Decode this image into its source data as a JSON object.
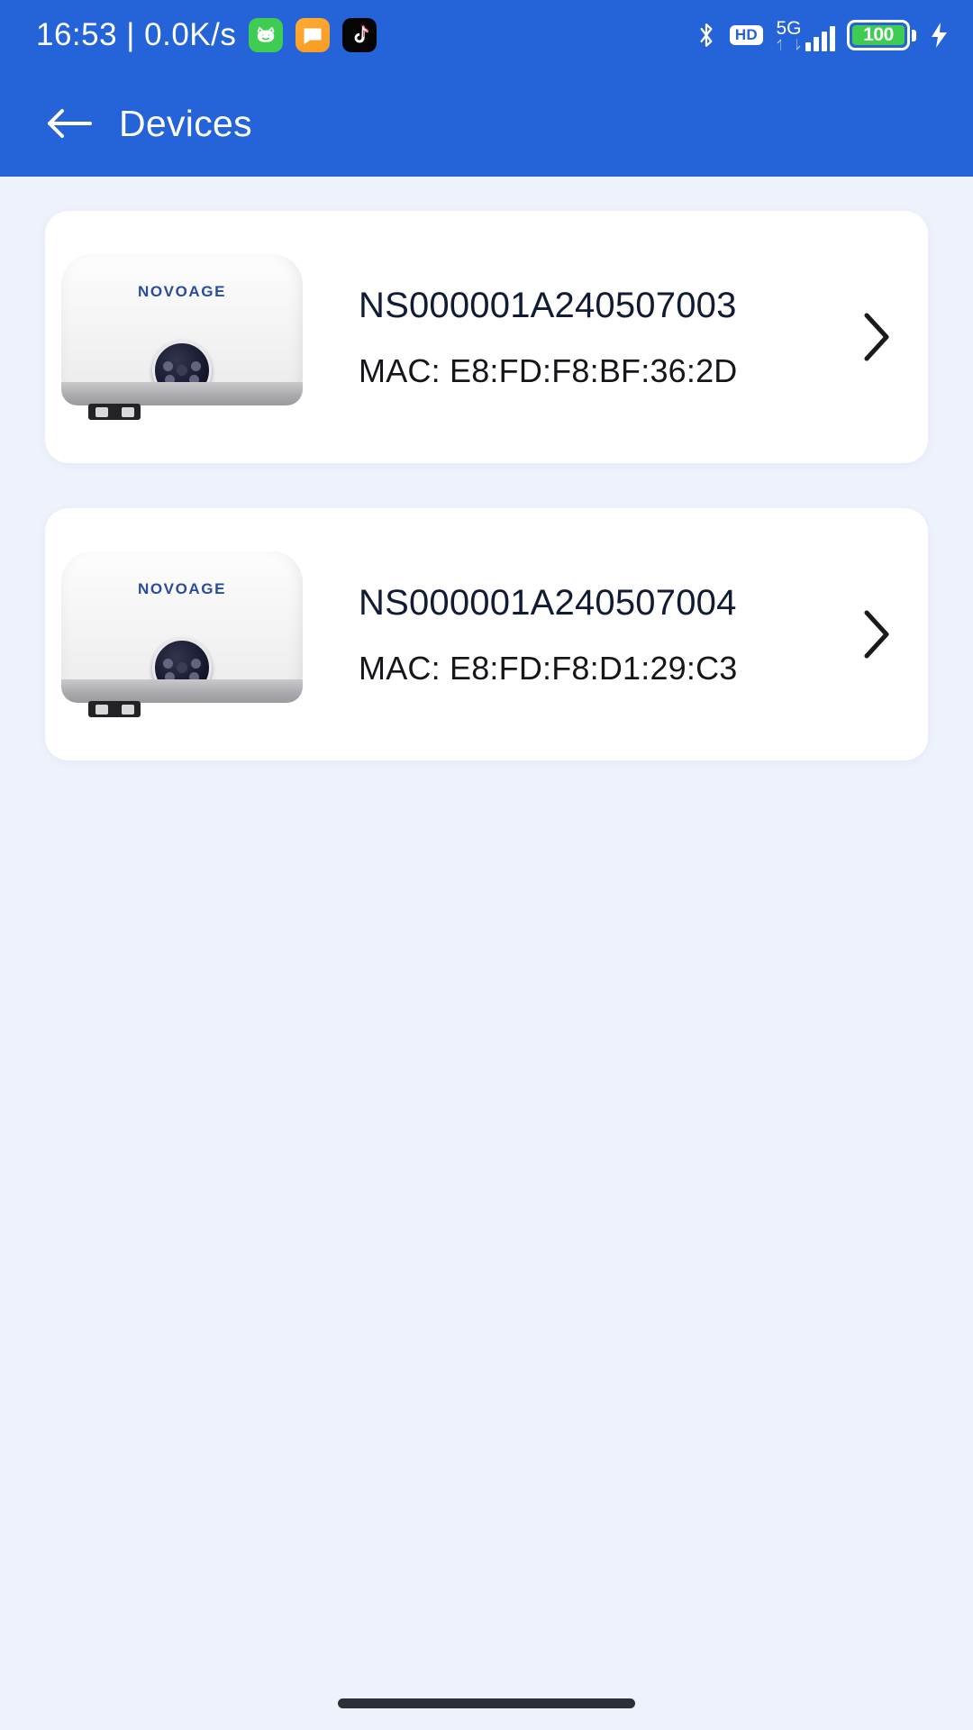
{
  "statusbar": {
    "clock": "16:53 | 0.0K/s",
    "app_icons": [
      {
        "name": "cat-app-icon",
        "color": "#3fcc52"
      },
      {
        "name": "message-app-icon",
        "color": "#f79a22"
      },
      {
        "name": "tiktok-app-icon",
        "color": "#050505"
      }
    ],
    "bluetooth_icon": "bluetooth-icon",
    "hd_label": "HD",
    "network_label": "5G",
    "data_arrows_icon": "data-transfer-icon",
    "signal_icon": "signal-bars-icon",
    "battery_level": "100",
    "battery_color": "#3fcc52",
    "charging_icon": "charging-bolt-icon"
  },
  "appbar": {
    "back_icon": "back-arrow-icon",
    "title": "Devices",
    "background": "#2563d9"
  },
  "devices": [
    {
      "id": "NS000001A240507003",
      "mac": "MAC: E8:FD:F8:BF:36:2D",
      "brand": "NOVOAGE",
      "chevron_icon": "chevron-right-icon"
    },
    {
      "id": "NS000001A240507004",
      "mac": "MAC: E8:FD:F8:D1:29:C3",
      "brand": "NOVOAGE",
      "chevron_icon": "chevron-right-icon"
    }
  ],
  "system": {
    "home_indicator": "home-indicator"
  }
}
